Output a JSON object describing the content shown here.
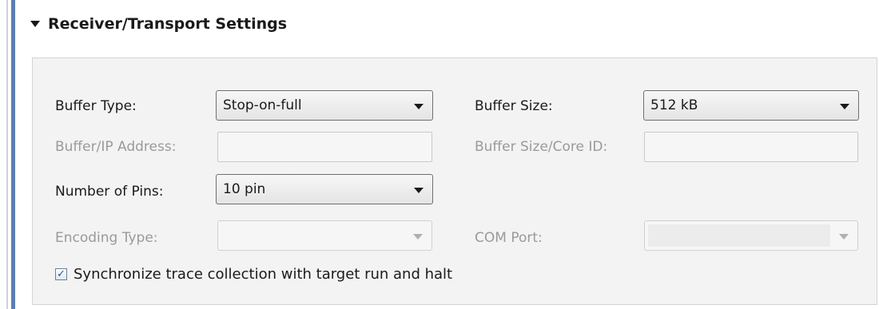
{
  "section": {
    "title": "Receiver/Transport Settings"
  },
  "fields": {
    "buffer_type": {
      "label": "Buffer Type:",
      "value": "Stop-on-full"
    },
    "buffer_size": {
      "label": "Buffer Size:",
      "value": "512 kB"
    },
    "buffer_ip_address": {
      "label": "Buffer/IP Address:",
      "value": ""
    },
    "buffer_size_core_id": {
      "label": "Buffer Size/Core ID:",
      "value": ""
    },
    "number_of_pins": {
      "label": "Number of Pins:",
      "value": "10 pin"
    },
    "encoding_type": {
      "label": "Encoding Type:",
      "value": ""
    },
    "com_port": {
      "label": "COM Port:",
      "value": ""
    }
  },
  "sync_checkbox": {
    "label": "Synchronize trace collection with target run and halt",
    "checked": true,
    "check_glyph": "✓"
  },
  "colors": {
    "accent_stripe": "#5a7fb3",
    "panel_background": "#f3f3f3",
    "disabled_text": "#9a9a9a"
  }
}
